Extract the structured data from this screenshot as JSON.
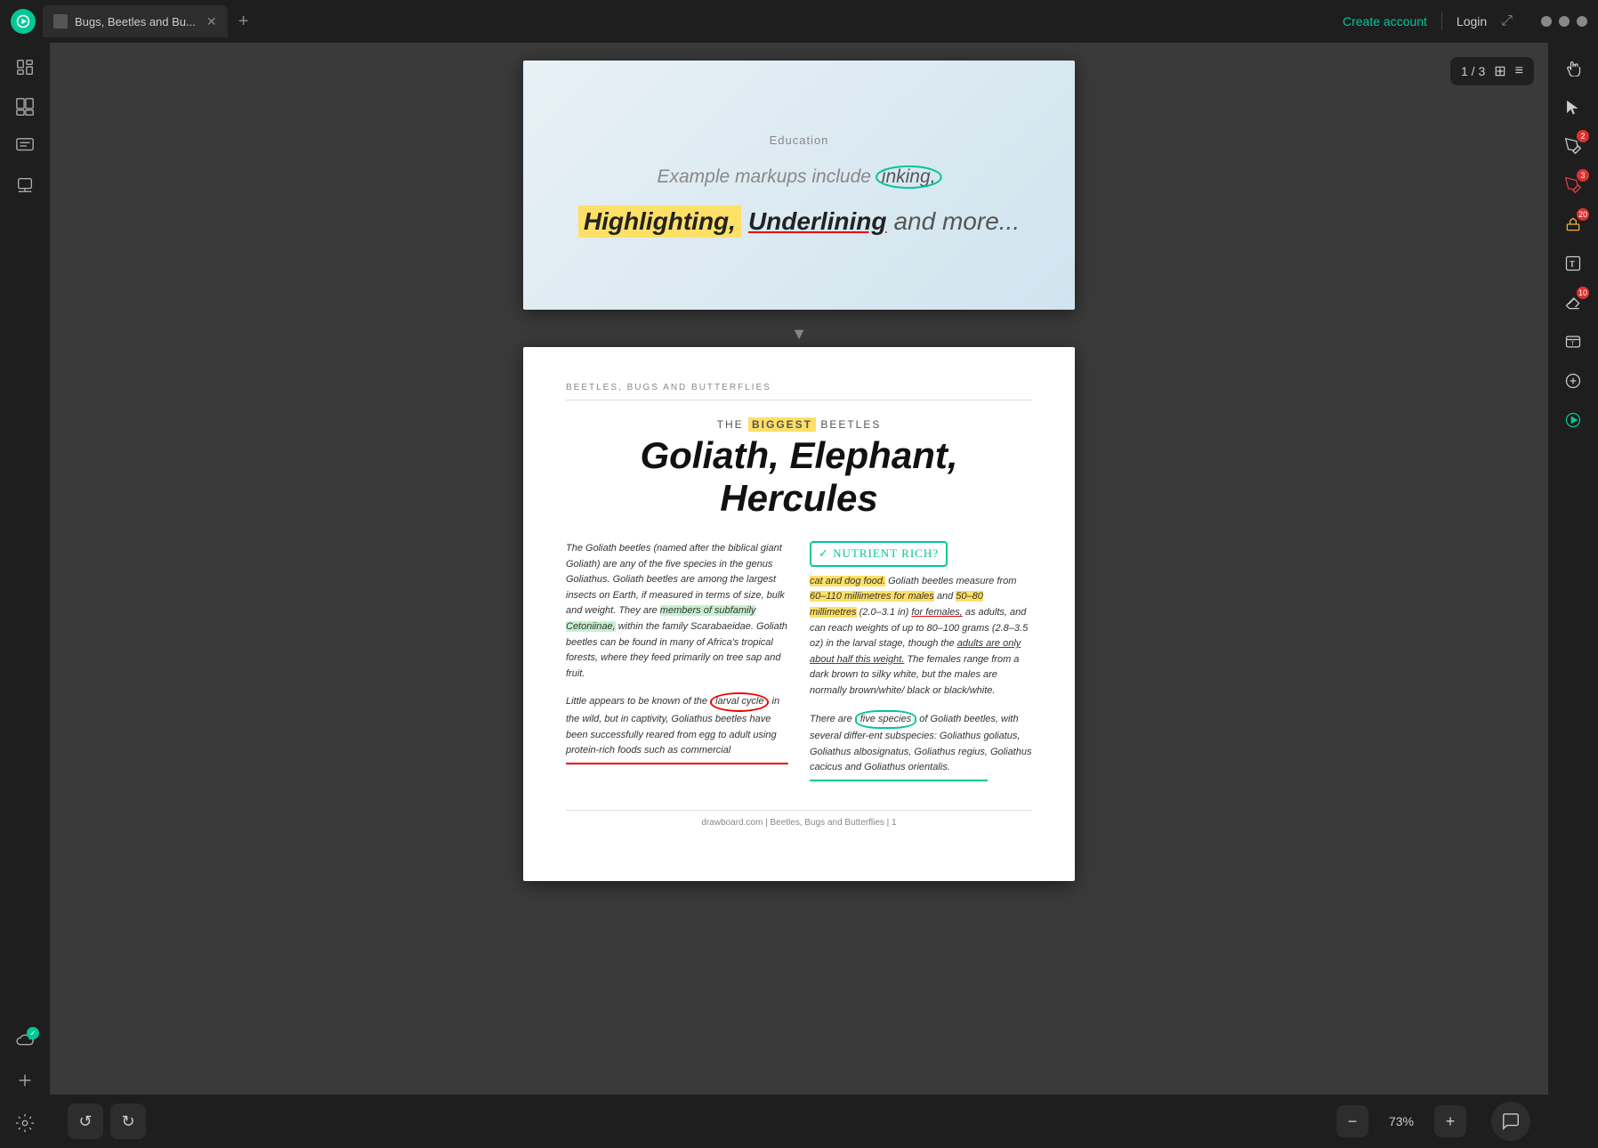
{
  "topbar": {
    "tab_label": "Bugs, Beetles and Bu...",
    "tab_modified": true,
    "new_tab_label": "+",
    "create_account": "Create account",
    "login": "Login"
  },
  "sidebar": {
    "items": [
      {
        "id": "library",
        "icon": "book"
      },
      {
        "id": "search",
        "icon": "search"
      },
      {
        "id": "comments",
        "icon": "chat"
      },
      {
        "id": "stamps",
        "icon": "stamp"
      },
      {
        "id": "cloud",
        "icon": "cloud",
        "badge": "✓"
      },
      {
        "id": "add",
        "icon": "plus"
      }
    ]
  },
  "pdf": {
    "page_current": 1,
    "page_total": 3,
    "zoom": "73%",
    "page1": {
      "category": "Education",
      "subtitle": "Example markups include inking,",
      "line2_highlight": "Highlighting,",
      "line2_underline": "Underlining",
      "line2_more": "and more..."
    },
    "page2": {
      "section": "BEETLES, BUGS AND BUTTERFLIES",
      "article_pre": "THE",
      "article_biggest": "BIGGEST",
      "article_rest": "BEETLES",
      "title": "Goliath, Elephant, Hercules",
      "nutrient_label": "NUTRIENT RICH?",
      "col1": [
        "The Goliath beetles (named after the biblical giant Goliath) are any of the five species in the genus Goliathus. Goliath beetles are among the largest insects on Earth, if measured in terms of size, bulk and weight. They are members of subfamily Cetoniinae, within the family Scarabaeidae. Goliath beetles can be found in many of Africa's tropical forests, where they feed primarily on tree sap and fruit.",
        "Little appears to be known of the larval cycle in the wild, but in captivity, Goliathus beetles have been successfully reared from egg to adult using protein-rich foods such as commercial"
      ],
      "col2": [
        "cat and dog food. Goliath beetles measure from 60–110 millimetres for males and 50–80 millimetres (2.0–3.1 in) for females as adults, and can reach weights of up to 80–100 grams (2.8–3.5 oz) in the larval stage, though the adults are only about half this weight. The females range from a dark brown to silky white, but the males are normally brown/white/black or black/white.",
        "There are five species of Goliath beetles, with several differ-ent subspecies: Goliathus goliatus, Goliathus albosignatus, Goliathus regius, Goliathus cacicus and Goliathus orientalis."
      ],
      "footer": "drawboard.com  |  Beetles, Bugs and Butterflies  |  1"
    }
  },
  "right_toolbar": {
    "items": [
      {
        "id": "hand",
        "icon": "hand"
      },
      {
        "id": "select",
        "icon": "arrow"
      },
      {
        "id": "annotate1",
        "icon": "pen",
        "badge": "2"
      },
      {
        "id": "annotate2",
        "icon": "marker",
        "badge": "3"
      },
      {
        "id": "annotate3",
        "icon": "highlighter",
        "badge": "20"
      },
      {
        "id": "text",
        "icon": "T"
      },
      {
        "id": "eraser",
        "icon": "eraser",
        "badge": "10"
      },
      {
        "id": "textbox",
        "icon": "textbox"
      },
      {
        "id": "add",
        "icon": "plus"
      },
      {
        "id": "drawboard",
        "icon": "drawboard"
      }
    ]
  },
  "bottombar": {
    "undo_label": "↺",
    "redo_label": "↻",
    "zoom_in": "+",
    "zoom_out": "−",
    "zoom_level": "73%"
  }
}
